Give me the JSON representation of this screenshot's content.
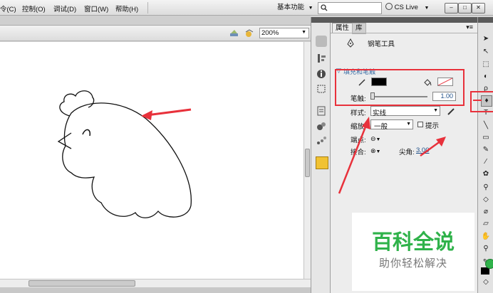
{
  "menu": {
    "items": [
      "令(C)",
      "控制(O)",
      "调试(D)",
      "窗口(W)",
      "帮助(H)"
    ],
    "workspace_label": "基本功能",
    "cs_live_label": "CS Live"
  },
  "stage": {
    "zoom": "200%"
  },
  "properties_panel": {
    "tabs": [
      "属性",
      "库"
    ],
    "tool_name": "钢笔工具",
    "section_title": "填充和笔触",
    "stroke_label": "笔触:",
    "stroke_value": "1.00",
    "style_label": "样式:",
    "style_value": "实线",
    "scale_label": "缩放:",
    "scale_value": "一般",
    "hint_label": "提示",
    "cap_label": "端点:",
    "join_label": "接合:",
    "miter_label": "尖角:",
    "miter_value": "3.00"
  },
  "watermark": {
    "title": "百科全说",
    "subtitle": "助你轻松解决"
  },
  "colors": {
    "accent_red": "#e8313b",
    "watermark_green": "#2fb24a"
  }
}
